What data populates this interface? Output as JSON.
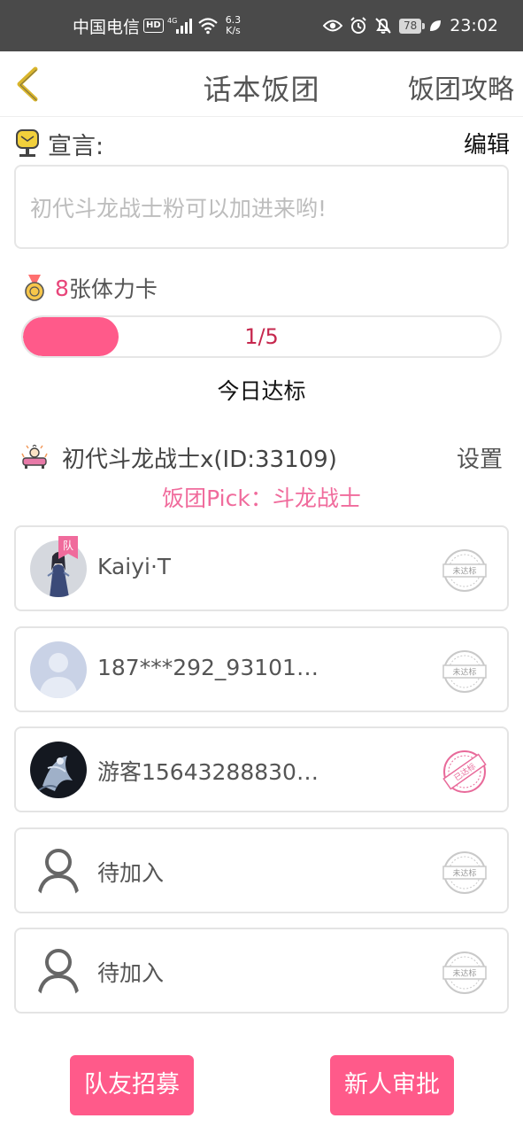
{
  "status_bar": {
    "carrier": "中国电信",
    "hd": "HD",
    "network": "4G",
    "speed_value": "6.3",
    "speed_unit": "K/s",
    "battery": "78",
    "time": "23:02"
  },
  "nav": {
    "title": "话本饭团",
    "action": "饭团攻略"
  },
  "declaration": {
    "label": "宣言:",
    "edit": "编辑",
    "text": "初代斗龙战士粉可以加进来哟!"
  },
  "stamina": {
    "count": "8",
    "label": "张体力卡",
    "progress_text": "1/5",
    "progress_fraction": 0.2,
    "today_label": "今日达标"
  },
  "team": {
    "name": "初代斗龙战士x(ID:33109)",
    "settings": "设置",
    "pick": "饭团Pick：斗龙战士",
    "captain_badge": "队"
  },
  "members": [
    {
      "name": "Kaiyi·T",
      "status": "未达标",
      "achieved": false
    },
    {
      "name": "187***292_93101…",
      "status": "未达标",
      "achieved": false
    },
    {
      "name": "游客15643288830…",
      "status": "已达标",
      "achieved": true
    },
    {
      "name": "待加入",
      "status": "未达标",
      "achieved": false
    },
    {
      "name": "待加入",
      "status": "未达标",
      "achieved": false
    }
  ],
  "buttons": {
    "recruit": "队友招募",
    "approve": "新人审批"
  },
  "colors": {
    "accent": "#ff5a8a",
    "accent_text": "#e8457a",
    "pick_text": "#f06b9c",
    "status_bar": "#4a4a4a",
    "back_arrow": "#d9b52c"
  }
}
